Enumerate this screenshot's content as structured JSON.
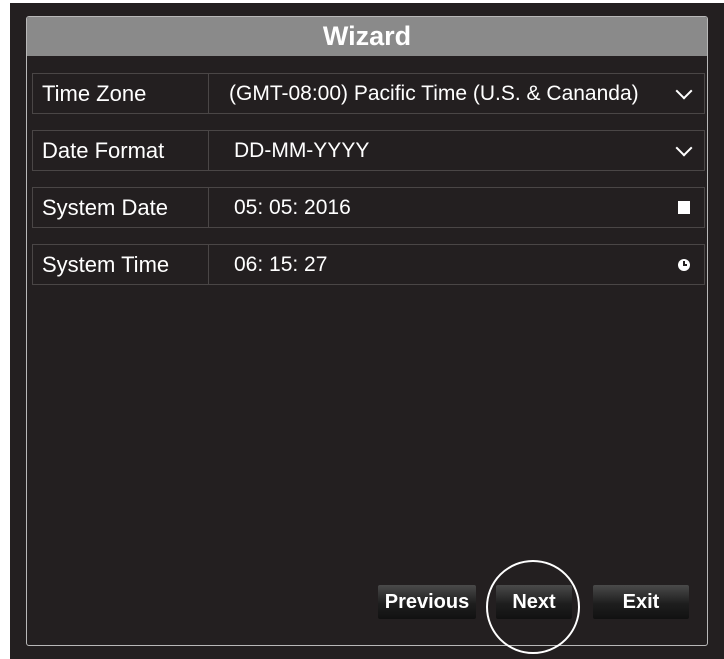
{
  "dialog": {
    "title": "Wizard"
  },
  "fields": [
    {
      "label": "Time Zone",
      "value": "(GMT-08:00) Pacific Time (U.S. & Cananda)",
      "control_icon": "chevron-down-icon"
    },
    {
      "label": "Date Format",
      "value": "DD-MM-YYYY",
      "control_icon": "chevron-down-icon"
    },
    {
      "label": "System Date",
      "value": "05: 05: 2016",
      "control_icon": "calendar-icon"
    },
    {
      "label": "System Time",
      "value": "06: 15: 27",
      "control_icon": "clock-icon"
    }
  ],
  "buttons": {
    "previous": "Previous",
    "next": "Next",
    "exit": "Exit"
  },
  "colors": {
    "background": "#231f20",
    "title_bar": "#8a8a8a",
    "text": "#ffffff",
    "row_border": "#4a4646"
  }
}
